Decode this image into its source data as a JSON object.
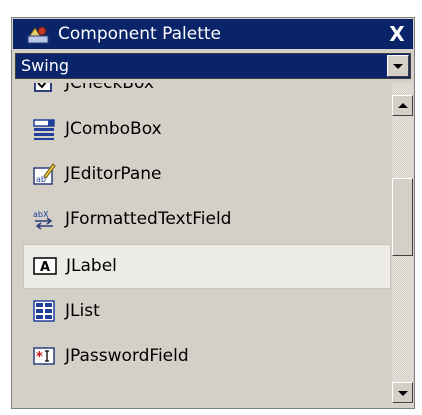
{
  "window": {
    "title": "Component Palette",
    "close_glyph": "X",
    "title_icon": "palette-icon",
    "close_icon": "close-icon"
  },
  "category_select": {
    "selected": "Swing"
  },
  "components": [
    {
      "label": "JCheckBox",
      "icon": "checkbox-icon",
      "partially_visible": true
    },
    {
      "label": "JComboBox",
      "icon": "combobox-icon"
    },
    {
      "label": "JEditorPane",
      "icon": "editor-pane-icon"
    },
    {
      "label": "JFormattedTextField",
      "icon": "formatted-text-field-icon"
    },
    {
      "label": "JLabel",
      "icon": "label-icon",
      "selected": true
    },
    {
      "label": "JList",
      "icon": "list-icon"
    },
    {
      "label": "JPasswordField",
      "icon": "password-field-icon"
    }
  ],
  "colors": {
    "title_bar": "#0a246a",
    "panel": "#d4d0c8",
    "selected_row": "#ecebe5"
  }
}
